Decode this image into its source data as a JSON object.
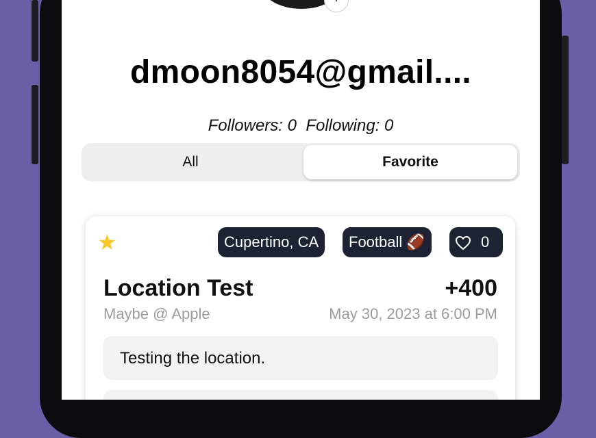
{
  "profile": {
    "username": "dmoon8054@gmail....",
    "follow_text": "Followers: 0  Following: 0"
  },
  "tabs": [
    {
      "label": "All",
      "selected": false
    },
    {
      "label": "Favorite",
      "selected": true
    }
  ],
  "post": {
    "favorited": true,
    "location": "Cupertino, CA",
    "sport": "Football 🏈",
    "likes": "0",
    "title": "Location Test",
    "odds": "+400",
    "subtitle": "Maybe @ Apple",
    "date": "May 30, 2023 at 6:00 PM",
    "note": "Testing the location."
  },
  "colors": {
    "background": "#6a5fa6",
    "pill": "#1e2333",
    "star": "#f8c72a"
  },
  "icons": [
    "avatar",
    "plus-icon",
    "star-icon",
    "heart-icon"
  ]
}
